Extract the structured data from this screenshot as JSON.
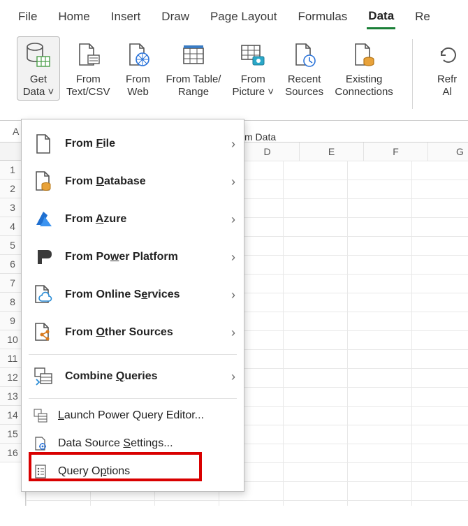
{
  "tabs": {
    "file": "File",
    "home": "Home",
    "insert": "Insert",
    "draw": "Draw",
    "pagelayout": "Page Layout",
    "formulas": "Formulas",
    "data": "Data",
    "re": "Re"
  },
  "ribbon": {
    "getdata_l1": "Get",
    "getdata_l2": "Data",
    "fromtext_l1": "From",
    "fromtext_l2": "Text/CSV",
    "fromweb_l1": "From",
    "fromweb_l2": "Web",
    "fromtable_l1": "From Table/",
    "fromtable_l2": "Range",
    "frompic_l1": "From",
    "frompic_l2": "Picture",
    "recent_l1": "Recent",
    "recent_l2": "Sources",
    "existing_l1": "Existing",
    "existing_l2": "Connections",
    "refresh_l1": "Refr",
    "refresh_l2": "Al",
    "group_label": "m Data"
  },
  "namebox": "A",
  "columns": [
    "D",
    "E",
    "F",
    "G"
  ],
  "rows": [
    "1",
    "2",
    "3",
    "4",
    "5",
    "6",
    "7",
    "8",
    "9",
    "10",
    "11",
    "12",
    "13",
    "14",
    "15",
    "16"
  ],
  "menu": {
    "from_file_pre": "From ",
    "from_file_u": "F",
    "from_file_post": "ile",
    "from_db_pre": "From ",
    "from_db_u": "D",
    "from_db_post": "atabase",
    "from_azure_pre": "From ",
    "from_azure_u": "A",
    "from_azure_post": "zure",
    "from_pp_pre": "From Po",
    "from_pp_u": "w",
    "from_pp_post": "er Platform",
    "from_os_pre": "From Online S",
    "from_os_u": "e",
    "from_os_post": "rvices",
    "from_other_pre": "From ",
    "from_other_u": "O",
    "from_other_post": "ther Sources",
    "combine_pre": "Combine ",
    "combine_u": "Q",
    "combine_post": "ueries",
    "launch_pre": "",
    "launch_u": "L",
    "launch_post": "aunch Power Query Editor...",
    "dss_pre": "Data Source ",
    "dss_u": "S",
    "dss_post": "ettings...",
    "qopt_pre": "Query O",
    "qopt_u": "p",
    "qopt_post": "tions"
  }
}
